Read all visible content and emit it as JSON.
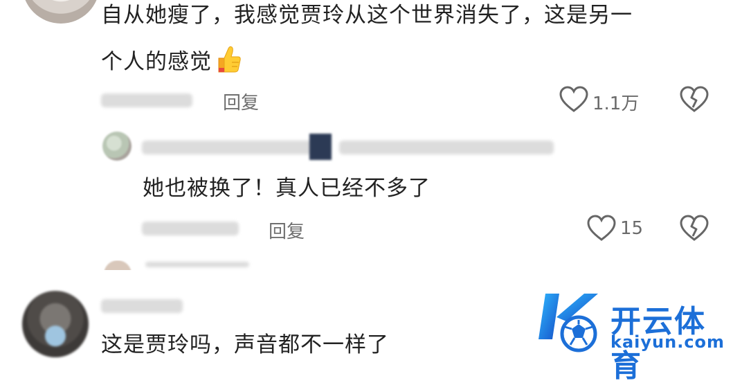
{
  "comment1": {
    "text_line1": "自从她瘦了，我感觉贾玲从这个世界消失了，这是另一",
    "text_line2": "个人的感觉",
    "emoji_icon": "thumbs-up-icon",
    "reply_label": "回复",
    "like_count": "1.1万"
  },
  "reply1": {
    "text": "她也被换了！真人已经不多了",
    "reply_label": "回复",
    "like_count": "15"
  },
  "comment2": {
    "text": "这是贾玲吗，声音都不一样了"
  },
  "watermark": {
    "brand": "开云体育",
    "url": "kaiyun.com",
    "accent": "#1c6fd8"
  }
}
